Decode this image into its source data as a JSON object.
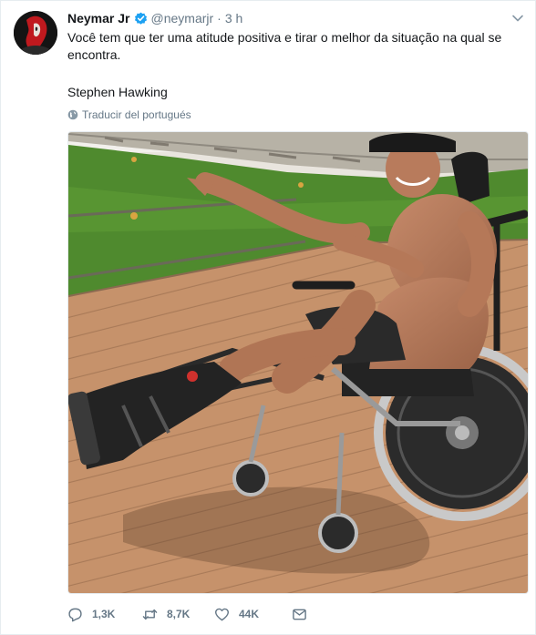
{
  "tweet": {
    "author_name": "Neymar Jr",
    "handle": "@neymarjr",
    "separator": "·",
    "time": "3 h",
    "text_line1": "Você tem que ter uma atitude positiva e tirar o melhor da situação na qual se",
    "text_line2": "encontra.",
    "text_line3": "Stephen Hawking",
    "translate_label": "Traducir del portugués"
  },
  "actions": {
    "replies": "1,3K",
    "retweets": "8,7K",
    "likes": "44K"
  },
  "icons": {
    "verified": "verified-badge-icon",
    "chevron": "chevron-down-icon",
    "globe": "globe-icon",
    "reply": "reply-icon",
    "retweet": "retweet-icon",
    "like": "heart-icon",
    "message": "envelope-icon"
  },
  "colors": {
    "verified_blue": "#1da1f2",
    "secondary_text": "#657786",
    "primary_text": "#14171a"
  }
}
